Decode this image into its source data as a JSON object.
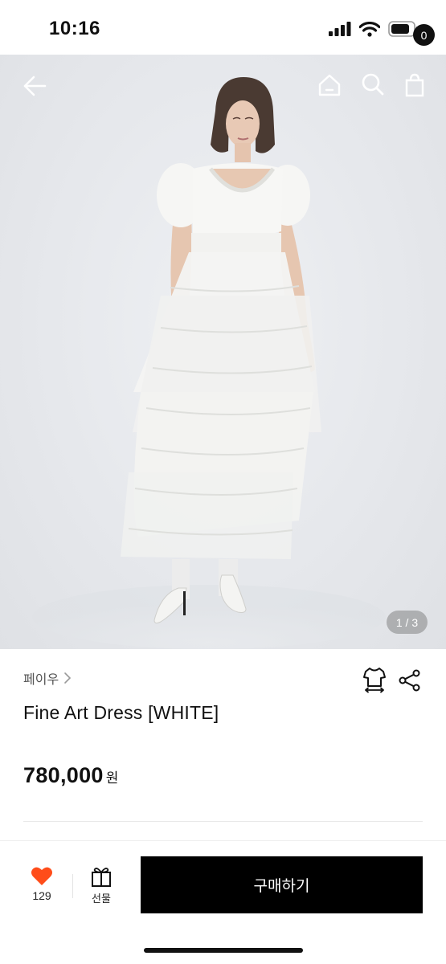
{
  "status_bar": {
    "time": "10:16"
  },
  "header": {
    "cart_count": "0"
  },
  "gallery": {
    "indicator": "1 / 3"
  },
  "product": {
    "brand": "페이우",
    "title": "Fine Art Dress [WHITE]",
    "price": "780,000",
    "currency": "원"
  },
  "bottom_bar": {
    "like_count": "129",
    "gift_label": "선물",
    "buy_label": "구매하기"
  },
  "colors": {
    "accent_heart": "#ff4d1a",
    "buy_button": "#000000"
  }
}
